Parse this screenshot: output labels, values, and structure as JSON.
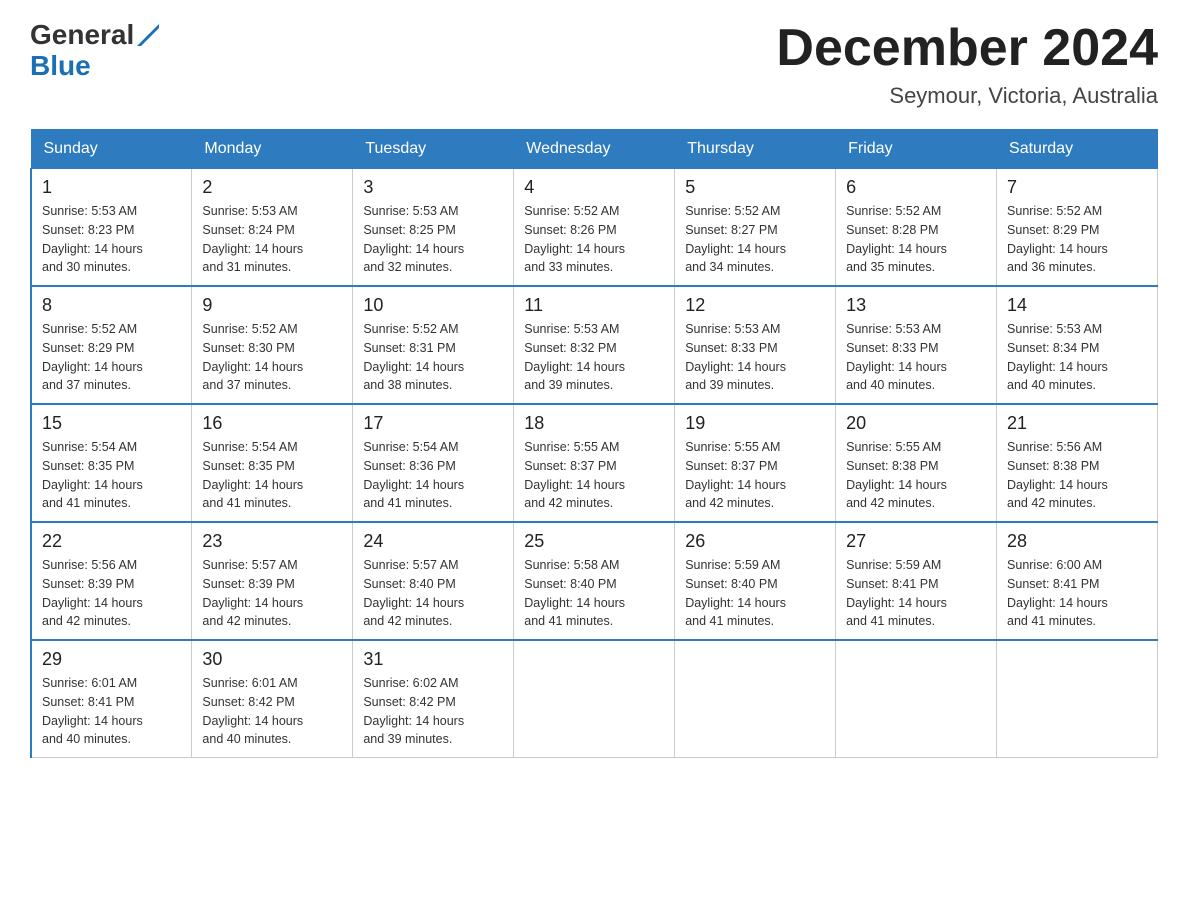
{
  "logo": {
    "text_general": "General",
    "text_blue": "Blue"
  },
  "title": "December 2024",
  "location": "Seymour, Victoria, Australia",
  "days_of_week": [
    "Sunday",
    "Monday",
    "Tuesday",
    "Wednesday",
    "Thursday",
    "Friday",
    "Saturday"
  ],
  "weeks": [
    [
      {
        "day": "1",
        "sunrise": "5:53 AM",
        "sunset": "8:23 PM",
        "daylight": "14 hours and 30 minutes."
      },
      {
        "day": "2",
        "sunrise": "5:53 AM",
        "sunset": "8:24 PM",
        "daylight": "14 hours and 31 minutes."
      },
      {
        "day": "3",
        "sunrise": "5:53 AM",
        "sunset": "8:25 PM",
        "daylight": "14 hours and 32 minutes."
      },
      {
        "day": "4",
        "sunrise": "5:52 AM",
        "sunset": "8:26 PM",
        "daylight": "14 hours and 33 minutes."
      },
      {
        "day": "5",
        "sunrise": "5:52 AM",
        "sunset": "8:27 PM",
        "daylight": "14 hours and 34 minutes."
      },
      {
        "day": "6",
        "sunrise": "5:52 AM",
        "sunset": "8:28 PM",
        "daylight": "14 hours and 35 minutes."
      },
      {
        "day": "7",
        "sunrise": "5:52 AM",
        "sunset": "8:29 PM",
        "daylight": "14 hours and 36 minutes."
      }
    ],
    [
      {
        "day": "8",
        "sunrise": "5:52 AM",
        "sunset": "8:29 PM",
        "daylight": "14 hours and 37 minutes."
      },
      {
        "day": "9",
        "sunrise": "5:52 AM",
        "sunset": "8:30 PM",
        "daylight": "14 hours and 37 minutes."
      },
      {
        "day": "10",
        "sunrise": "5:52 AM",
        "sunset": "8:31 PM",
        "daylight": "14 hours and 38 minutes."
      },
      {
        "day": "11",
        "sunrise": "5:53 AM",
        "sunset": "8:32 PM",
        "daylight": "14 hours and 39 minutes."
      },
      {
        "day": "12",
        "sunrise": "5:53 AM",
        "sunset": "8:33 PM",
        "daylight": "14 hours and 39 minutes."
      },
      {
        "day": "13",
        "sunrise": "5:53 AM",
        "sunset": "8:33 PM",
        "daylight": "14 hours and 40 minutes."
      },
      {
        "day": "14",
        "sunrise": "5:53 AM",
        "sunset": "8:34 PM",
        "daylight": "14 hours and 40 minutes."
      }
    ],
    [
      {
        "day": "15",
        "sunrise": "5:54 AM",
        "sunset": "8:35 PM",
        "daylight": "14 hours and 41 minutes."
      },
      {
        "day": "16",
        "sunrise": "5:54 AM",
        "sunset": "8:35 PM",
        "daylight": "14 hours and 41 minutes."
      },
      {
        "day": "17",
        "sunrise": "5:54 AM",
        "sunset": "8:36 PM",
        "daylight": "14 hours and 41 minutes."
      },
      {
        "day": "18",
        "sunrise": "5:55 AM",
        "sunset": "8:37 PM",
        "daylight": "14 hours and 42 minutes."
      },
      {
        "day": "19",
        "sunrise": "5:55 AM",
        "sunset": "8:37 PM",
        "daylight": "14 hours and 42 minutes."
      },
      {
        "day": "20",
        "sunrise": "5:55 AM",
        "sunset": "8:38 PM",
        "daylight": "14 hours and 42 minutes."
      },
      {
        "day": "21",
        "sunrise": "5:56 AM",
        "sunset": "8:38 PM",
        "daylight": "14 hours and 42 minutes."
      }
    ],
    [
      {
        "day": "22",
        "sunrise": "5:56 AM",
        "sunset": "8:39 PM",
        "daylight": "14 hours and 42 minutes."
      },
      {
        "day": "23",
        "sunrise": "5:57 AM",
        "sunset": "8:39 PM",
        "daylight": "14 hours and 42 minutes."
      },
      {
        "day": "24",
        "sunrise": "5:57 AM",
        "sunset": "8:40 PM",
        "daylight": "14 hours and 42 minutes."
      },
      {
        "day": "25",
        "sunrise": "5:58 AM",
        "sunset": "8:40 PM",
        "daylight": "14 hours and 41 minutes."
      },
      {
        "day": "26",
        "sunrise": "5:59 AM",
        "sunset": "8:40 PM",
        "daylight": "14 hours and 41 minutes."
      },
      {
        "day": "27",
        "sunrise": "5:59 AM",
        "sunset": "8:41 PM",
        "daylight": "14 hours and 41 minutes."
      },
      {
        "day": "28",
        "sunrise": "6:00 AM",
        "sunset": "8:41 PM",
        "daylight": "14 hours and 41 minutes."
      }
    ],
    [
      {
        "day": "29",
        "sunrise": "6:01 AM",
        "sunset": "8:41 PM",
        "daylight": "14 hours and 40 minutes."
      },
      {
        "day": "30",
        "sunrise": "6:01 AM",
        "sunset": "8:42 PM",
        "daylight": "14 hours and 40 minutes."
      },
      {
        "day": "31",
        "sunrise": "6:02 AM",
        "sunset": "8:42 PM",
        "daylight": "14 hours and 39 minutes."
      },
      null,
      null,
      null,
      null
    ]
  ],
  "labels": {
    "sunrise": "Sunrise:",
    "sunset": "Sunset:",
    "daylight": "Daylight:"
  }
}
